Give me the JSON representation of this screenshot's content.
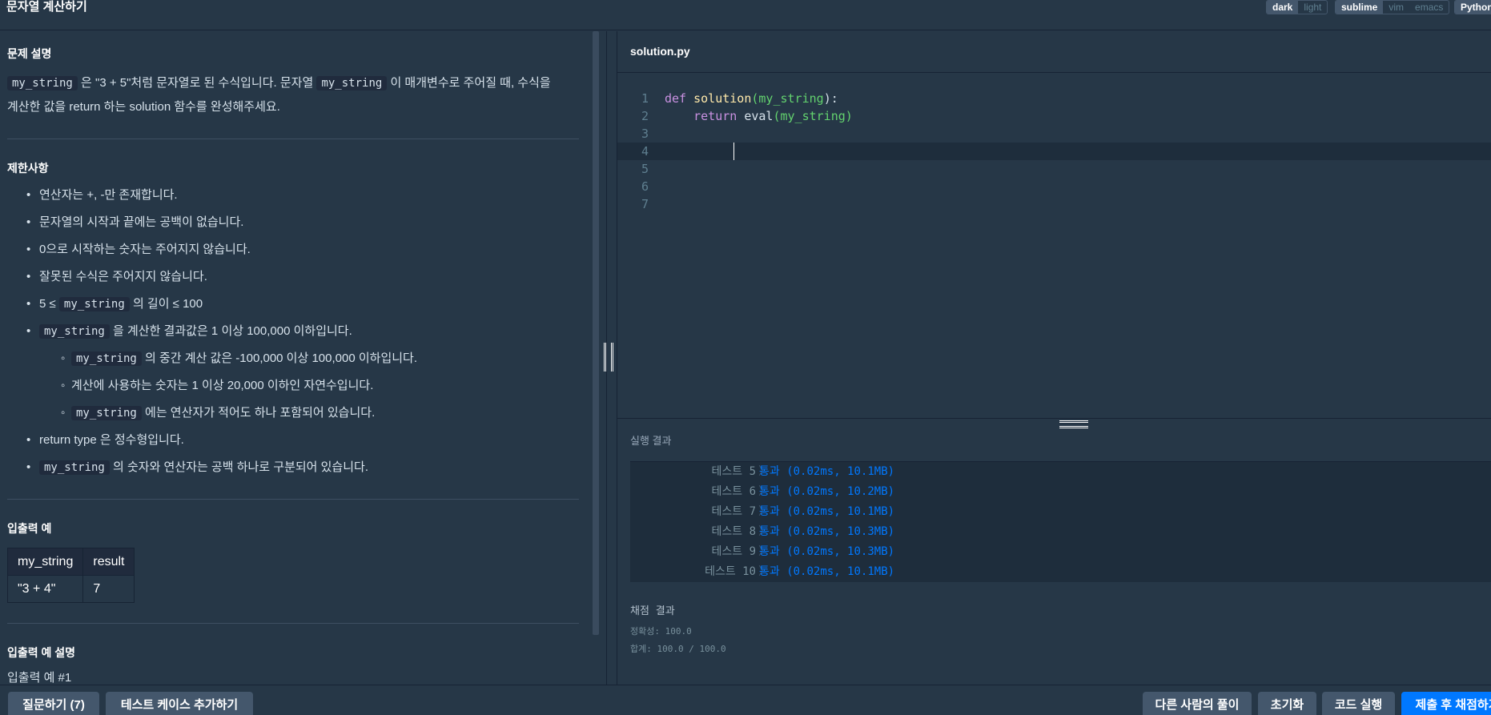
{
  "header": {
    "title": "문자열 계산하기",
    "theme_options": [
      "dark",
      "light"
    ],
    "theme_selected": "dark",
    "keymap_options": [
      "sublime",
      "vim",
      "emacs"
    ],
    "keymap_selected": "sublime",
    "language": "Python"
  },
  "problem": {
    "description_title": "문제 설명",
    "description": {
      "code1": "my_string",
      "text1": " 은 \"3 + 5\"처럼 문자열로 된 수식입니다. 문자열 ",
      "code2": "my_string",
      "text2": " 이 매개변수로 주어질 때, 수식을",
      "line2": "계산한 값을 return 하는 solution 함수를 완성해주세요."
    },
    "constraints_title": "제한사항",
    "constraints": {
      "c1": "연산자는 +, -만 존재합니다.",
      "c2": "문자열의 시작과 끝에는 공백이 없습니다.",
      "c3": "0으로 시작하는 숫자는 주어지지 않습니다.",
      "c4": "잘못된 수식은 주어지지 않습니다.",
      "c5_pre": "5 ≤ ",
      "c5_code": "my_string",
      "c5_post": " 의 길이 ≤ 100",
      "c6_code": "my_string",
      "c6_post": " 을 계산한 결과값은 1 이상 100,000 이하입니다.",
      "s1_code": "my_string",
      "s1_post": " 의 중간 계산 값은 -100,000 이상 100,000 이하입니다.",
      "s2": "계산에 사용하는 숫자는 1 이상 20,000 이하인 자연수입니다.",
      "s3_code": "my_string",
      "s3_post": " 에는 연산자가 적어도 하나 포함되어 있습니다.",
      "c7": "return type 은 정수형입니다.",
      "c8_code": "my_string",
      "c8_post": " 의 숫자와 연산자는 공백 하나로 구분되어 있습니다."
    },
    "io_title": "입출력 예",
    "io_table": {
      "headers": [
        "my_string",
        "result"
      ],
      "rows": [
        [
          "\"3 + 4\"",
          "7"
        ]
      ]
    },
    "io_desc_title": "입출력 예 설명",
    "io_desc_sub": "입출력 예 #1"
  },
  "editor": {
    "filename": "solution.py",
    "line_numbers": [
      "1",
      "2",
      "3",
      "4",
      "5",
      "6",
      "7"
    ],
    "line1": {
      "kw": "def",
      "fn": "solution",
      "open": "(",
      "param": "my_string",
      "close": "):"
    },
    "line2": {
      "kw": "return",
      "bi": "eval",
      "open": "(",
      "param": "my_string",
      "close": ")"
    }
  },
  "results": {
    "title": "실행 결과",
    "tests": [
      {
        "label": "테스트 5",
        "value": "통과 (0.02ms, 10.1MB)"
      },
      {
        "label": "테스트 6",
        "value": "통과 (0.02ms, 10.2MB)"
      },
      {
        "label": "테스트 7",
        "value": "통과 (0.02ms, 10.1MB)"
      },
      {
        "label": "테스트 8",
        "value": "통과 (0.02ms, 10.3MB)"
      },
      {
        "label": "테스트 9",
        "value": "통과 (0.02ms, 10.3MB)"
      },
      {
        "label": "테스트 10",
        "value": "통과 (0.02ms, 10.1MB)"
      }
    ],
    "score_title": "채점 결과",
    "accuracy": "정확성: 100.0",
    "total": "합계: 100.0 / 100.0"
  },
  "footer": {
    "ask_label": "질문하기 (7)",
    "add_test_label": "테스트 케이스 추가하기",
    "others_label": "다른 사람의 풀이",
    "reset_label": "초기화",
    "run_label": "코드 실행",
    "submit_label": "제출 후 채점하기"
  },
  "colors": {
    "background": "#263747",
    "dark_panel": "#1e2d3c",
    "accent": "#0078ff",
    "keyword": "#c991e1",
    "function": "#ffe9aa",
    "param": "#63d26e"
  }
}
